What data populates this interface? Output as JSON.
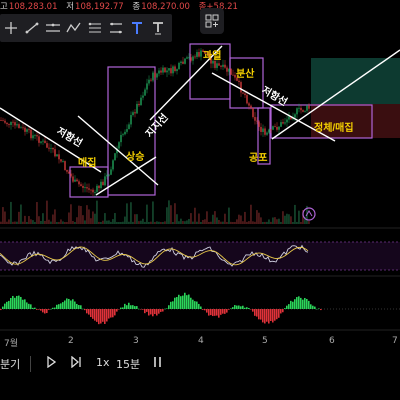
{
  "ohlc": {
    "high_label": "고",
    "high": "108,283.01",
    "low_label": "저",
    "low": "108,192.77",
    "close_label": "종",
    "close": "108,270.00",
    "change": "종+58.21"
  },
  "toolbar": {
    "tools": [
      "crosshair-icon",
      "trendline-icon",
      "horizontal-line-icon",
      "pattern-icon",
      "fib-icon",
      "ruler-icon",
      "text-tool-icon",
      "anchored-text-icon"
    ]
  },
  "annotations": {
    "resistance_left": "저항선",
    "accumulate": "매집",
    "rise": "상승",
    "support": "지지선",
    "overheat": "과열",
    "dispersion": "분산",
    "resistance_right": "저항선",
    "fear": "공포",
    "stagnation": "정체/매집"
  },
  "xaxis": [
    "7월",
    "2",
    "3",
    "4",
    "5",
    "6",
    "7"
  ],
  "bottombar": {
    "period_label": "분기",
    "speed_label": "1x",
    "interval_label": "15분"
  },
  "colors": {
    "bull": "#1fa35a",
    "bear": "#d43b3b",
    "box": "#b064d8",
    "annotation": "#f5d000",
    "target_zone": "#0d3a30",
    "signal_line": "#e7c84a"
  }
}
